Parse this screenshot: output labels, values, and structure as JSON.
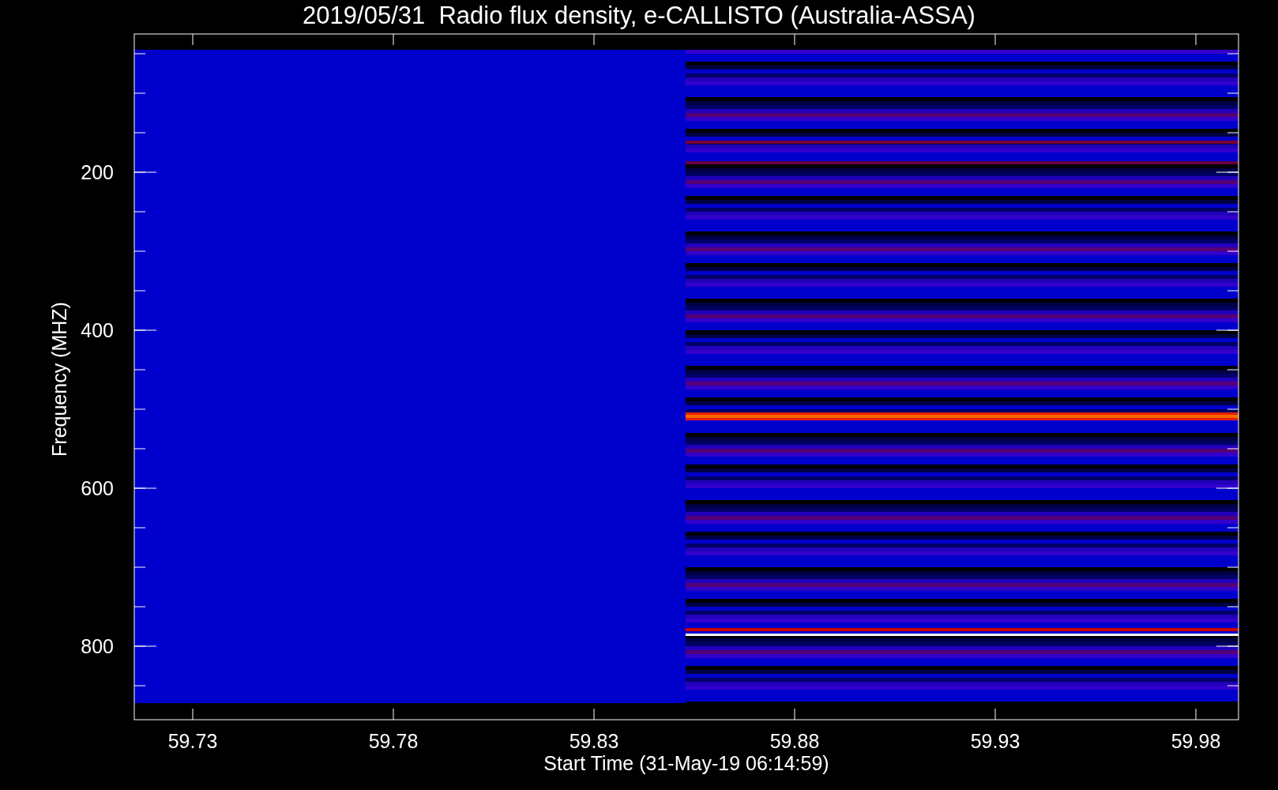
{
  "title": "2019/05/31  Radio flux density, e-CALLISTO (Australia-ASSA)",
  "y_axis": {
    "label": "Frequency (MHZ)",
    "ticks": [
      "200",
      "400",
      "600",
      "800"
    ]
  },
  "x_axis": {
    "label": "Start Time (31-May-19 06:14:59)",
    "ticks": [
      "59.73",
      "59.78",
      "59.83",
      "59.88",
      "59.93",
      "59.98"
    ]
  }
}
